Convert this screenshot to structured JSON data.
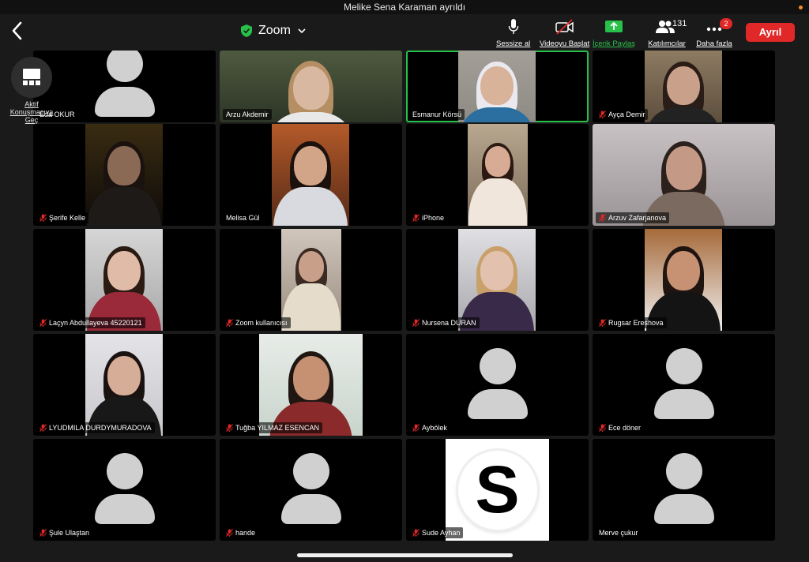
{
  "notification": "Melike Sena Karaman ayrıldı",
  "meeting": {
    "title": "Zoom"
  },
  "toolbar": {
    "mute": "Sessize al",
    "video": "Videoyu Başlat",
    "share": "İçerik Paylaş",
    "participants": "Katılımcılar",
    "participants_count": "131",
    "more": "Daha fazla",
    "more_badge": "2",
    "leave": "Ayrıl"
  },
  "side": {
    "label": "Aktif Konuşmacıya Geç"
  },
  "colors": {
    "accent_green": "#27c14a",
    "leave_red": "#e02828",
    "mic_off_red": "#e02828"
  },
  "participants": [
    {
      "name": "Eda OKUR",
      "muted": false
    },
    {
      "name": "Arzu Akdemir",
      "muted": false
    },
    {
      "name": "Esmanur Körsü",
      "muted": false
    },
    {
      "name": "Ayça Demir",
      "muted": true
    },
    {
      "name": "Şerife Kelle",
      "muted": true
    },
    {
      "name": "Melisa Gül",
      "muted": false
    },
    {
      "name": "iPhone",
      "muted": true
    },
    {
      "name": "Arzuv Zafarjanova",
      "muted": true
    },
    {
      "name": "Laçyn Abdullayeva 45220121",
      "muted": true
    },
    {
      "name": "Zoom kullanıcısı",
      "muted": true
    },
    {
      "name": "Nursena DURAN",
      "muted": true
    },
    {
      "name": "Rugsar Ereshova",
      "muted": true
    },
    {
      "name": "LYUDMILA DURDYMURADOVA",
      "muted": true
    },
    {
      "name": "Tuğba YILMAZ ESENCAN",
      "muted": true
    },
    {
      "name": "Aybölek",
      "muted": true
    },
    {
      "name": "Ece döner",
      "muted": true
    },
    {
      "name": "Şule Ulaştan",
      "muted": true
    },
    {
      "name": "hande",
      "muted": true
    },
    {
      "name": "Sude Ayhan",
      "muted": true
    },
    {
      "name": "Merve çukur",
      "muted": false
    }
  ],
  "sude_logo_letter": "S"
}
